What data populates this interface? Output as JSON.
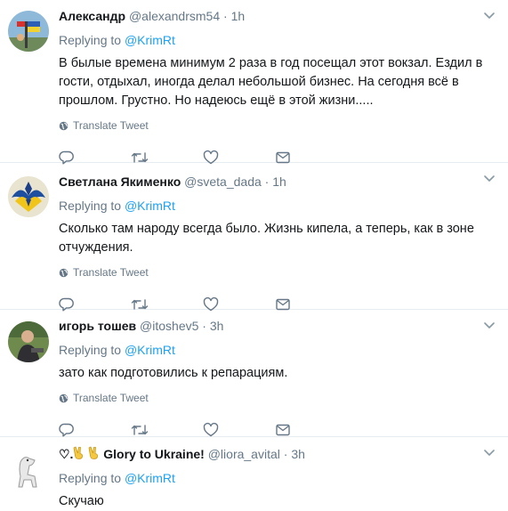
{
  "tweets": [
    {
      "name": "Александр",
      "handle": "@alexandrsm54",
      "dot": "·",
      "time": "1h",
      "reply_prefix": "Replying to",
      "reply_to": "@KrimRt",
      "text": "В былые времена минимум 2 раза в год посещал этот вокзал. Ездил в гости, отдыхал, иногда делал небольшой бизнес. На сегодня всё в прошлом. Грустно. Но надеюсь ещё в этой жизни.....",
      "translate": "Translate Tweet"
    },
    {
      "name": "Светлана Якименко",
      "handle": "@sveta_dada",
      "dot": "·",
      "time": "1h",
      "reply_prefix": "Replying to",
      "reply_to": "@KrimRt",
      "text": "Сколько там народу всегда было. Жизнь кипела, а теперь, как в зоне отчуждения.",
      "translate": "Translate Tweet"
    },
    {
      "name": "игорь тошев",
      "handle": "@itoshev5",
      "dot": "·",
      "time": "3h",
      "reply_prefix": "Replying to",
      "reply_to": "@KrimRt",
      "text": "зато как подготовились к репарациям.",
      "translate": "Translate Tweet"
    },
    {
      "name_prefix": "♡.",
      "name_main": "Glory to Ukraine!",
      "handle": "@liora_avital",
      "dot": "·",
      "time": "3h",
      "reply_prefix": "Replying to",
      "reply_to": "@KrimRt",
      "text": "Скучаю"
    }
  ],
  "icons": {
    "more": "chevron-down-icon",
    "globe": "globe-icon",
    "reply": "reply-icon",
    "retweet": "retweet-icon",
    "like": "heart-icon",
    "dm": "envelope-icon",
    "victory": "victory-hand-emoji"
  },
  "colors": {
    "link": "#1da1f2",
    "muted": "#657786",
    "text": "#14171a",
    "divider": "#e6ecf0"
  }
}
